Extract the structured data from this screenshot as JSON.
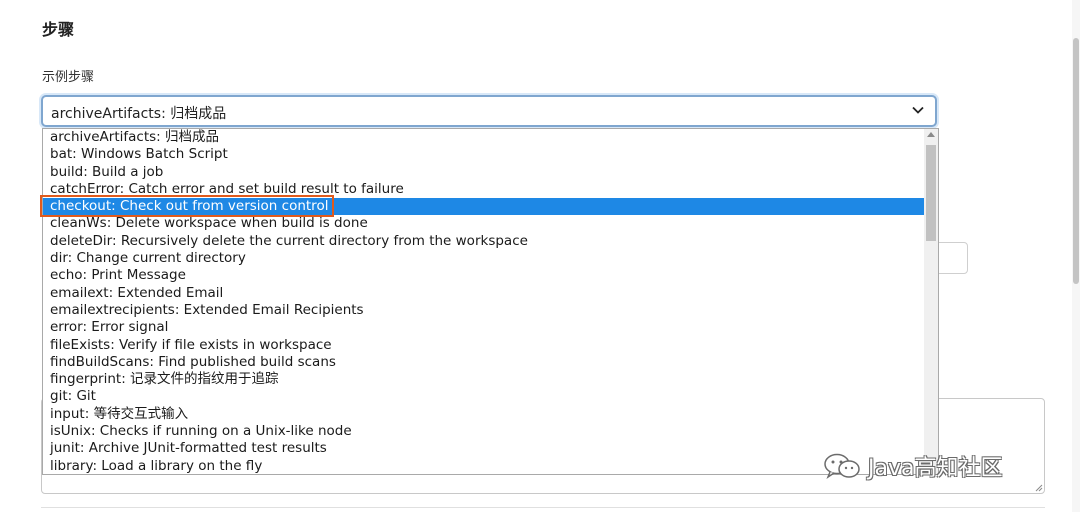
{
  "section": {
    "heading": "步骤"
  },
  "field": {
    "label": "示例步骤",
    "selected_value": "archiveArtifacts: 归档成品"
  },
  "dropdown": {
    "selected_index": 4,
    "options": [
      "archiveArtifacts: 归档成品",
      "bat: Windows Batch Script",
      "build: Build a job",
      "catchError: Catch error and set build result to failure",
      "checkout: Check out from version control",
      "cleanWs: Delete workspace when build is done",
      "deleteDir: Recursively delete the current directory from the workspace",
      "dir: Change current directory",
      "echo: Print Message",
      "emailext: Extended Email",
      "emailextrecipients: Extended Email Recipients",
      "error: Error signal",
      "fileExists: Verify if file exists in workspace",
      "findBuildScans: Find published build scans",
      "fingerprint: 记录文件的指纹用于追踪",
      "git: Git",
      "input: 等待交互式输入",
      "isUnix: Checks if running on a Unix-like node",
      "junit: Archive JUnit-formatted test results",
      "library: Load a library on the fly"
    ]
  },
  "watermark": {
    "text": "Java高知社区"
  },
  "icons": {
    "chevron": "chevron-down-icon",
    "watermark": "wechat-icon",
    "resize": "resize-grip-icon"
  },
  "colors": {
    "selection": "#1e88e5",
    "highlight_border": "#e05a1c",
    "focus_border": "#7fa6cf"
  }
}
